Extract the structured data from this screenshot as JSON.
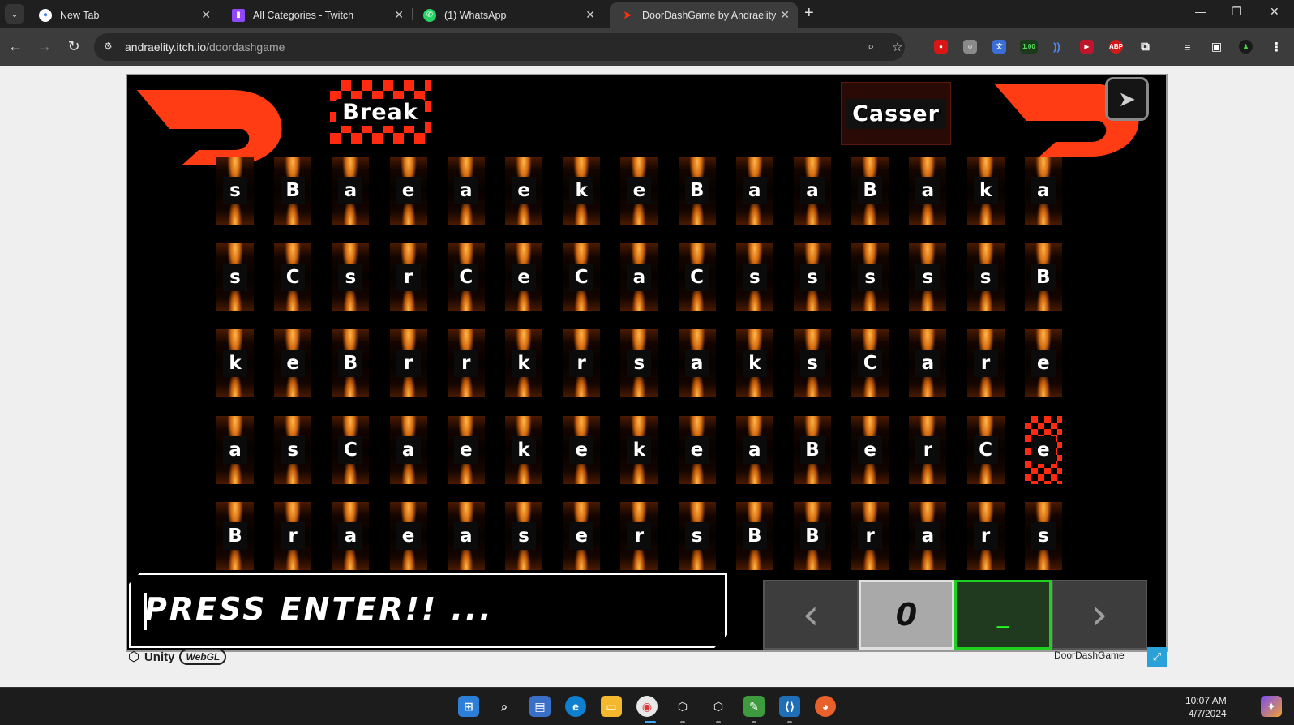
{
  "browser": {
    "tabs": [
      {
        "title": "New Tab",
        "icon": "chrome-icon",
        "color": "#ffffff"
      },
      {
        "title": "All Categories - Twitch",
        "icon": "twitch-icon",
        "color": "#9146ff"
      },
      {
        "title": "(1) WhatsApp",
        "icon": "whatsapp-icon",
        "color": "#25d366"
      },
      {
        "title": "DoorDashGame by Andraelity",
        "icon": "doordash-icon",
        "color": "#ff3008"
      }
    ],
    "url_host": "andraelity.itch.io",
    "url_path": "/doordashgame",
    "ext_badge": "1.00",
    "abp_label": "ABP"
  },
  "game": {
    "word_left": "Break",
    "word_right": "Casser",
    "grid": [
      [
        "s",
        "B",
        "a",
        "e",
        "a",
        "e",
        "k",
        "e",
        "B",
        "a",
        "a",
        "B",
        "a",
        "k",
        "a"
      ],
      [
        "s",
        "C",
        "s",
        "r",
        "C",
        "e",
        "C",
        "a",
        "C",
        "s",
        "s",
        "s",
        "s",
        "s",
        "B"
      ],
      [
        "k",
        "e",
        "B",
        "r",
        "r",
        "k",
        "r",
        "s",
        "a",
        "k",
        "s",
        "C",
        "a",
        "r",
        "e"
      ],
      [
        "a",
        "s",
        "C",
        "a",
        "e",
        "k",
        "e",
        "k",
        "e",
        "a",
        "B",
        "e",
        "r",
        "C",
        "e"
      ],
      [
        "B",
        "r",
        "a",
        "e",
        "a",
        "s",
        "e",
        "r",
        "s",
        "B",
        "B",
        "r",
        "a",
        "r",
        "s"
      ]
    ],
    "selected_tile": {
      "row": 3,
      "col": 14
    },
    "prompt": "PRESS ENTER!! ...",
    "controls": {
      "prev": "‹",
      "count": "0",
      "current": "_",
      "next": "›"
    },
    "accent": "#ff3c14"
  },
  "footer": {
    "unity": "Unity",
    "webgl": "WebGL",
    "title": "DoorDashGame"
  },
  "taskbar": {
    "time": "10:07 AM",
    "date": "4/7/2024"
  }
}
